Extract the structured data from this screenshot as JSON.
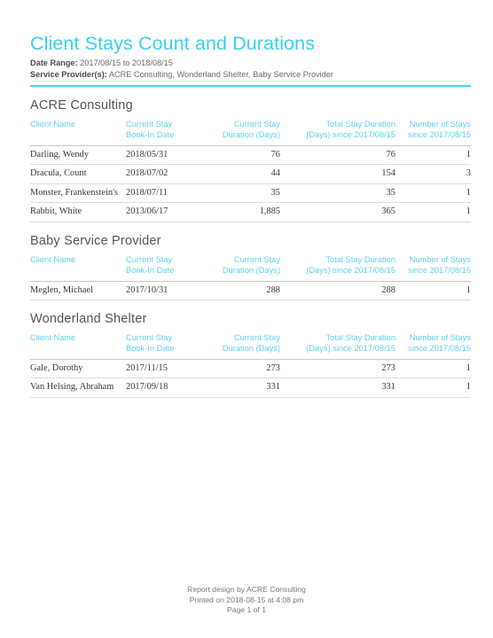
{
  "report": {
    "title": "Client Stays Count and Durations",
    "date_range_label": "Date Range:",
    "date_range_value": "2017/08/15 to 2018/08/15",
    "service_provider_label": "Service Provider(s):",
    "service_provider_value": "ACRE Consulting, Wonderland Shelter, Baby Service Provider",
    "accent_color": "#45d4f4",
    "header_text_color": "#5ed2ee",
    "body_text_color": "#3a3a3a"
  },
  "columns": {
    "name": "Client Name",
    "book_in_l1": "Current Stay",
    "book_in_l2": "Book-In Date",
    "duration_l1": "Current Stay",
    "duration_l2": "Duration (Days)",
    "total_l1": "Total Stay Duration",
    "total_l2": "(Days) since 2017/08/15",
    "count_l1": "Number of Stays",
    "count_l2": "since 2017/08/15"
  },
  "sections": [
    {
      "title": "ACRE Consulting",
      "rows": [
        {
          "name": "Darling, Wendy",
          "book_in": "2018/05/31",
          "duration": "76",
          "total": "76",
          "count": "1"
        },
        {
          "name": "Dracula, Count",
          "book_in": "2018/07/02",
          "duration": "44",
          "total": "154",
          "count": "3"
        },
        {
          "name": "Monster, Frankenstein's",
          "book_in": "2018/07/11",
          "duration": "35",
          "total": "35",
          "count": "1"
        },
        {
          "name": "Rabbit, White",
          "book_in": "2013/06/17",
          "duration": "1,885",
          "total": "365",
          "count": "1"
        }
      ]
    },
    {
      "title": "Baby Service Provider",
      "rows": [
        {
          "name": "Meglen, Michael",
          "book_in": "2017/10/31",
          "duration": "288",
          "total": "288",
          "count": "1"
        }
      ]
    },
    {
      "title": "Wonderland Shelter",
      "rows": [
        {
          "name": "Gale, Dorothy",
          "book_in": "2017/11/15",
          "duration": "273",
          "total": "273",
          "count": "1"
        },
        {
          "name": "Van Helsing, Abraham",
          "book_in": "2017/09/18",
          "duration": "331",
          "total": "331",
          "count": "1"
        }
      ]
    }
  ],
  "footer": {
    "line1": "Report design by ACRE Consulting",
    "line2": "Printed on 2018-08-15 at  4:08 pm",
    "line3": "Page 1 of 1"
  }
}
